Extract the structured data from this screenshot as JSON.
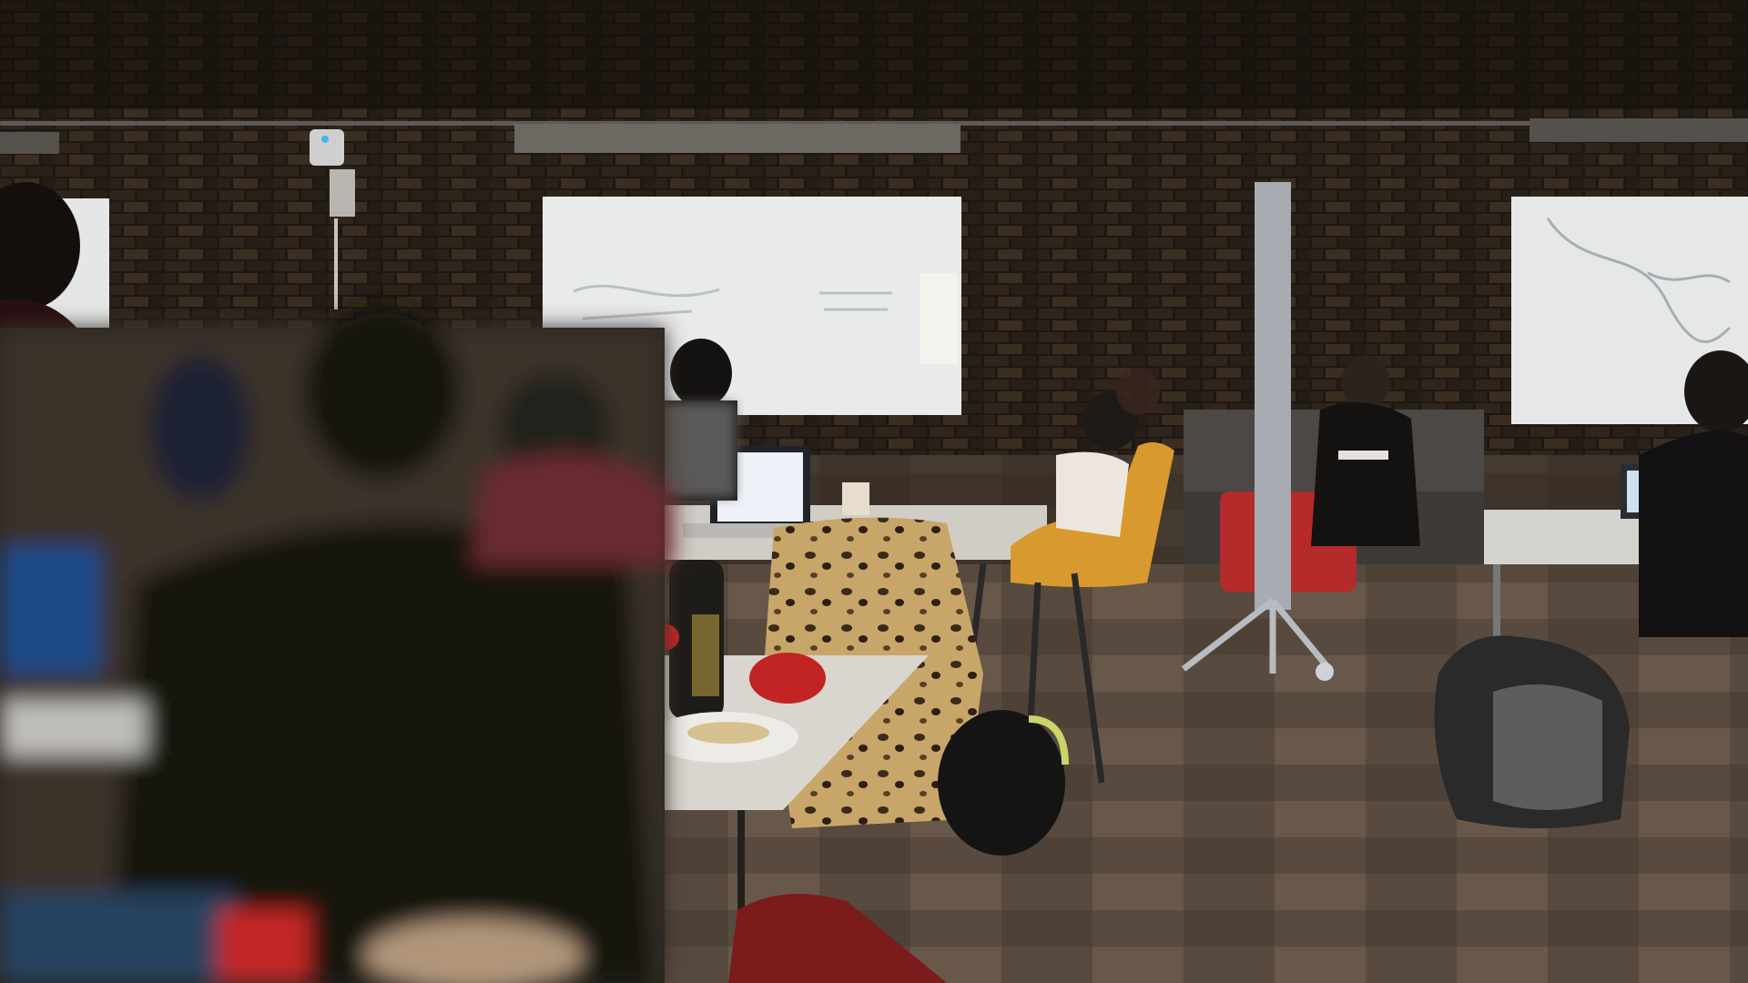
{
  "scene": {
    "kind": "photo",
    "colors": {
      "wall_brick": "#3a2c22",
      "wall_dark": "#1e1813",
      "floor": "#5a4c40",
      "whiteboard": "#e9ebea",
      "table": "#d8d6cf",
      "leopard_base": "#c8a66a",
      "orange_chair": "#d89a2e",
      "red_bag": "#b52a2a",
      "laptop_screen": "#eef2f8"
    },
    "objects": [
      "whiteboard-left",
      "whiteboard-center",
      "whiteboard-right",
      "brick-wall",
      "carpet-floor",
      "table",
      "laptop",
      "leopard-blanket",
      "orange-chair",
      "red-luggage",
      "backpack",
      "water-bottle",
      "people"
    ]
  }
}
